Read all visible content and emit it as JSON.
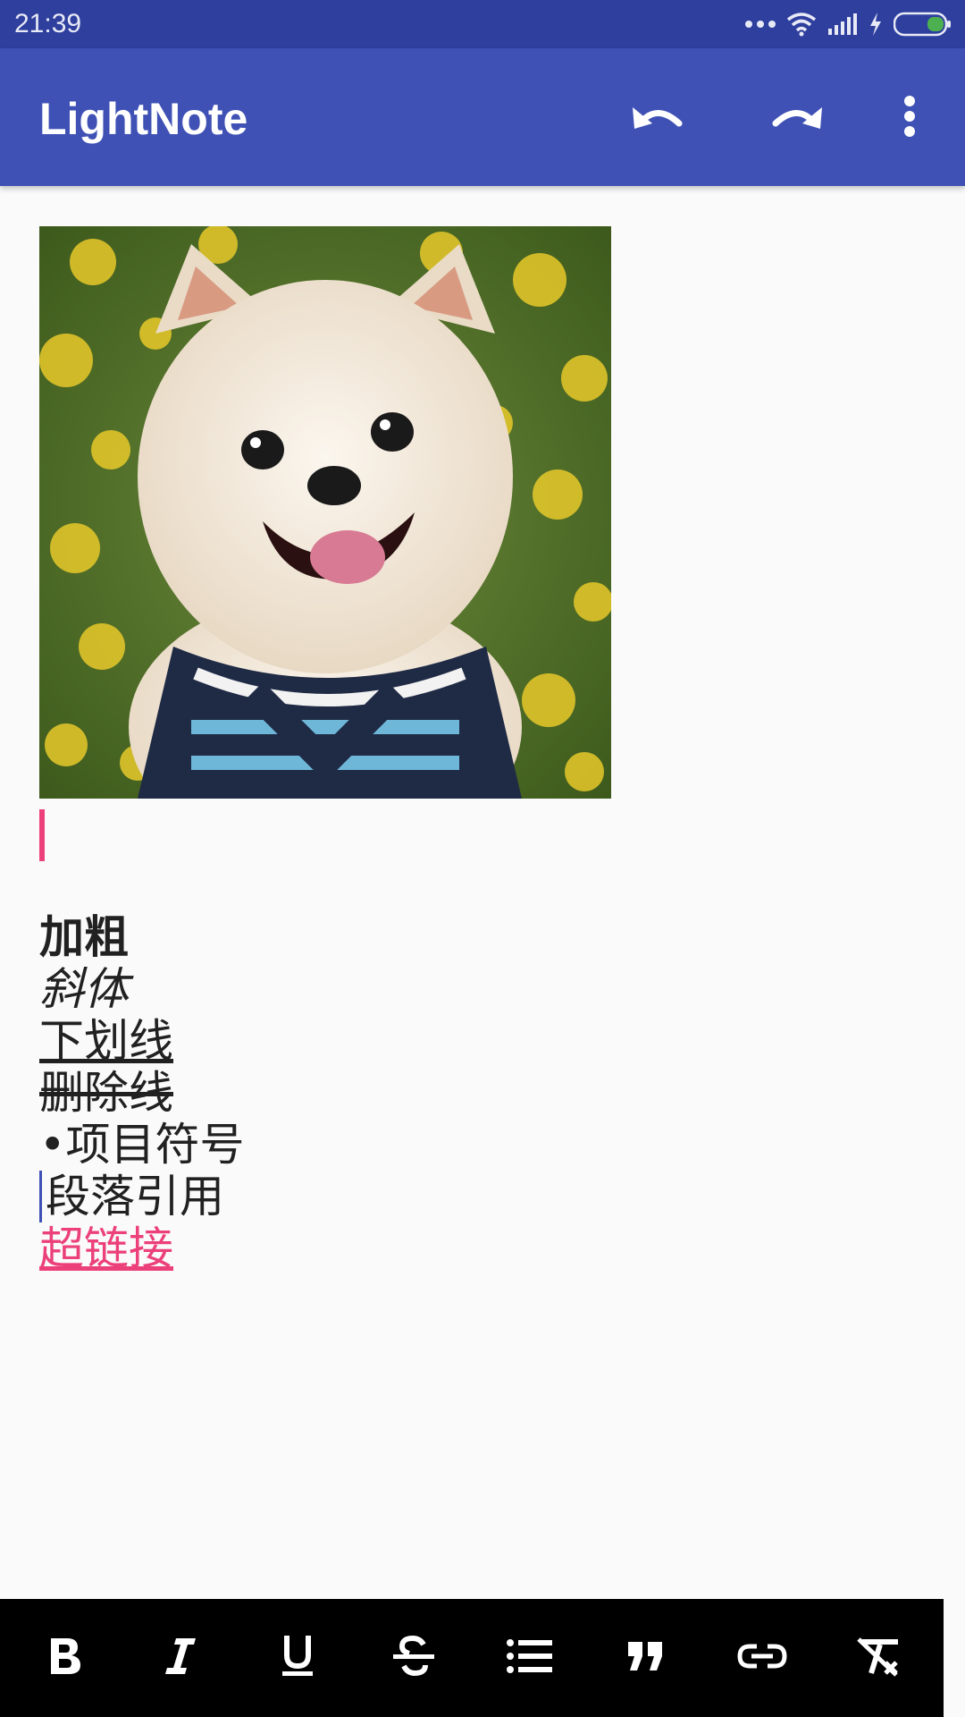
{
  "status_bar": {
    "time": "21:39"
  },
  "app_bar": {
    "title": "LightNote",
    "actions": [
      "undo-icon",
      "redo-icon",
      "more-vert-icon"
    ]
  },
  "editor": {
    "image": {
      "subject": "dog-photo"
    },
    "lines": {
      "bold": "加粗",
      "italic": "斜体",
      "underline": "下划线",
      "strikethrough": "删除线",
      "bullet": "•项目符号",
      "quote": "段落引用",
      "link": "超链接"
    }
  },
  "toolbar": {
    "buttons": [
      "bold-icon",
      "italic-icon",
      "underline-icon",
      "strikethrough-icon",
      "bullet-list-icon",
      "quote-icon",
      "link-icon",
      "clear-format-icon"
    ]
  },
  "colors": {
    "primary": "#3f51b5",
    "primary_dark": "#2f3f9e",
    "accent": "#ec407a",
    "toolbar_bg": "#000000",
    "battery": "#4caf50"
  }
}
